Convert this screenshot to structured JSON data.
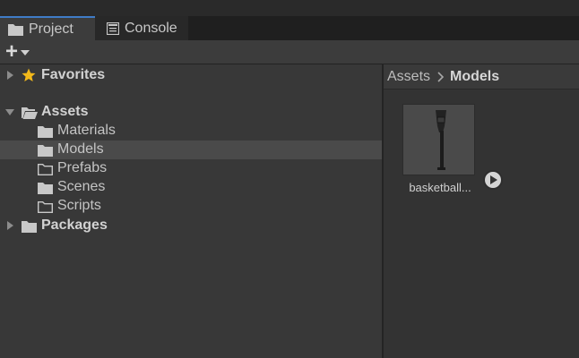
{
  "tabs": [
    {
      "label": "Project",
      "icon": "folder-icon",
      "active": true
    },
    {
      "label": "Console",
      "icon": "console-icon",
      "active": false
    }
  ],
  "toolbar": {
    "add_label": "+",
    "add_icon": "plus-icon"
  },
  "tree": {
    "favorites": {
      "label": "Favorites",
      "icon": "star-icon",
      "expanded": false
    },
    "assets": {
      "label": "Assets",
      "icon": "folder-open-icon",
      "expanded": true,
      "children": [
        {
          "label": "Materials",
          "icon": "folder-icon",
          "empty": false,
          "selected": false
        },
        {
          "label": "Models",
          "icon": "folder-icon",
          "empty": false,
          "selected": true
        },
        {
          "label": "Prefabs",
          "icon": "folder-empty-icon",
          "empty": true,
          "selected": false
        },
        {
          "label": "Scenes",
          "icon": "folder-icon",
          "empty": false,
          "selected": false
        },
        {
          "label": "Scripts",
          "icon": "folder-empty-icon",
          "empty": true,
          "selected": false
        }
      ]
    },
    "packages": {
      "label": "Packages",
      "icon": "folder-icon",
      "expanded": false
    }
  },
  "breadcrumb": {
    "root": "Assets",
    "current": "Models"
  },
  "assets_grid": [
    {
      "label": "basketball...",
      "type": "model"
    }
  ],
  "colors": {
    "accent": "#3f7cc7",
    "star": "#f2b81a",
    "background": "#383838",
    "selection": "#4a4a4a"
  }
}
